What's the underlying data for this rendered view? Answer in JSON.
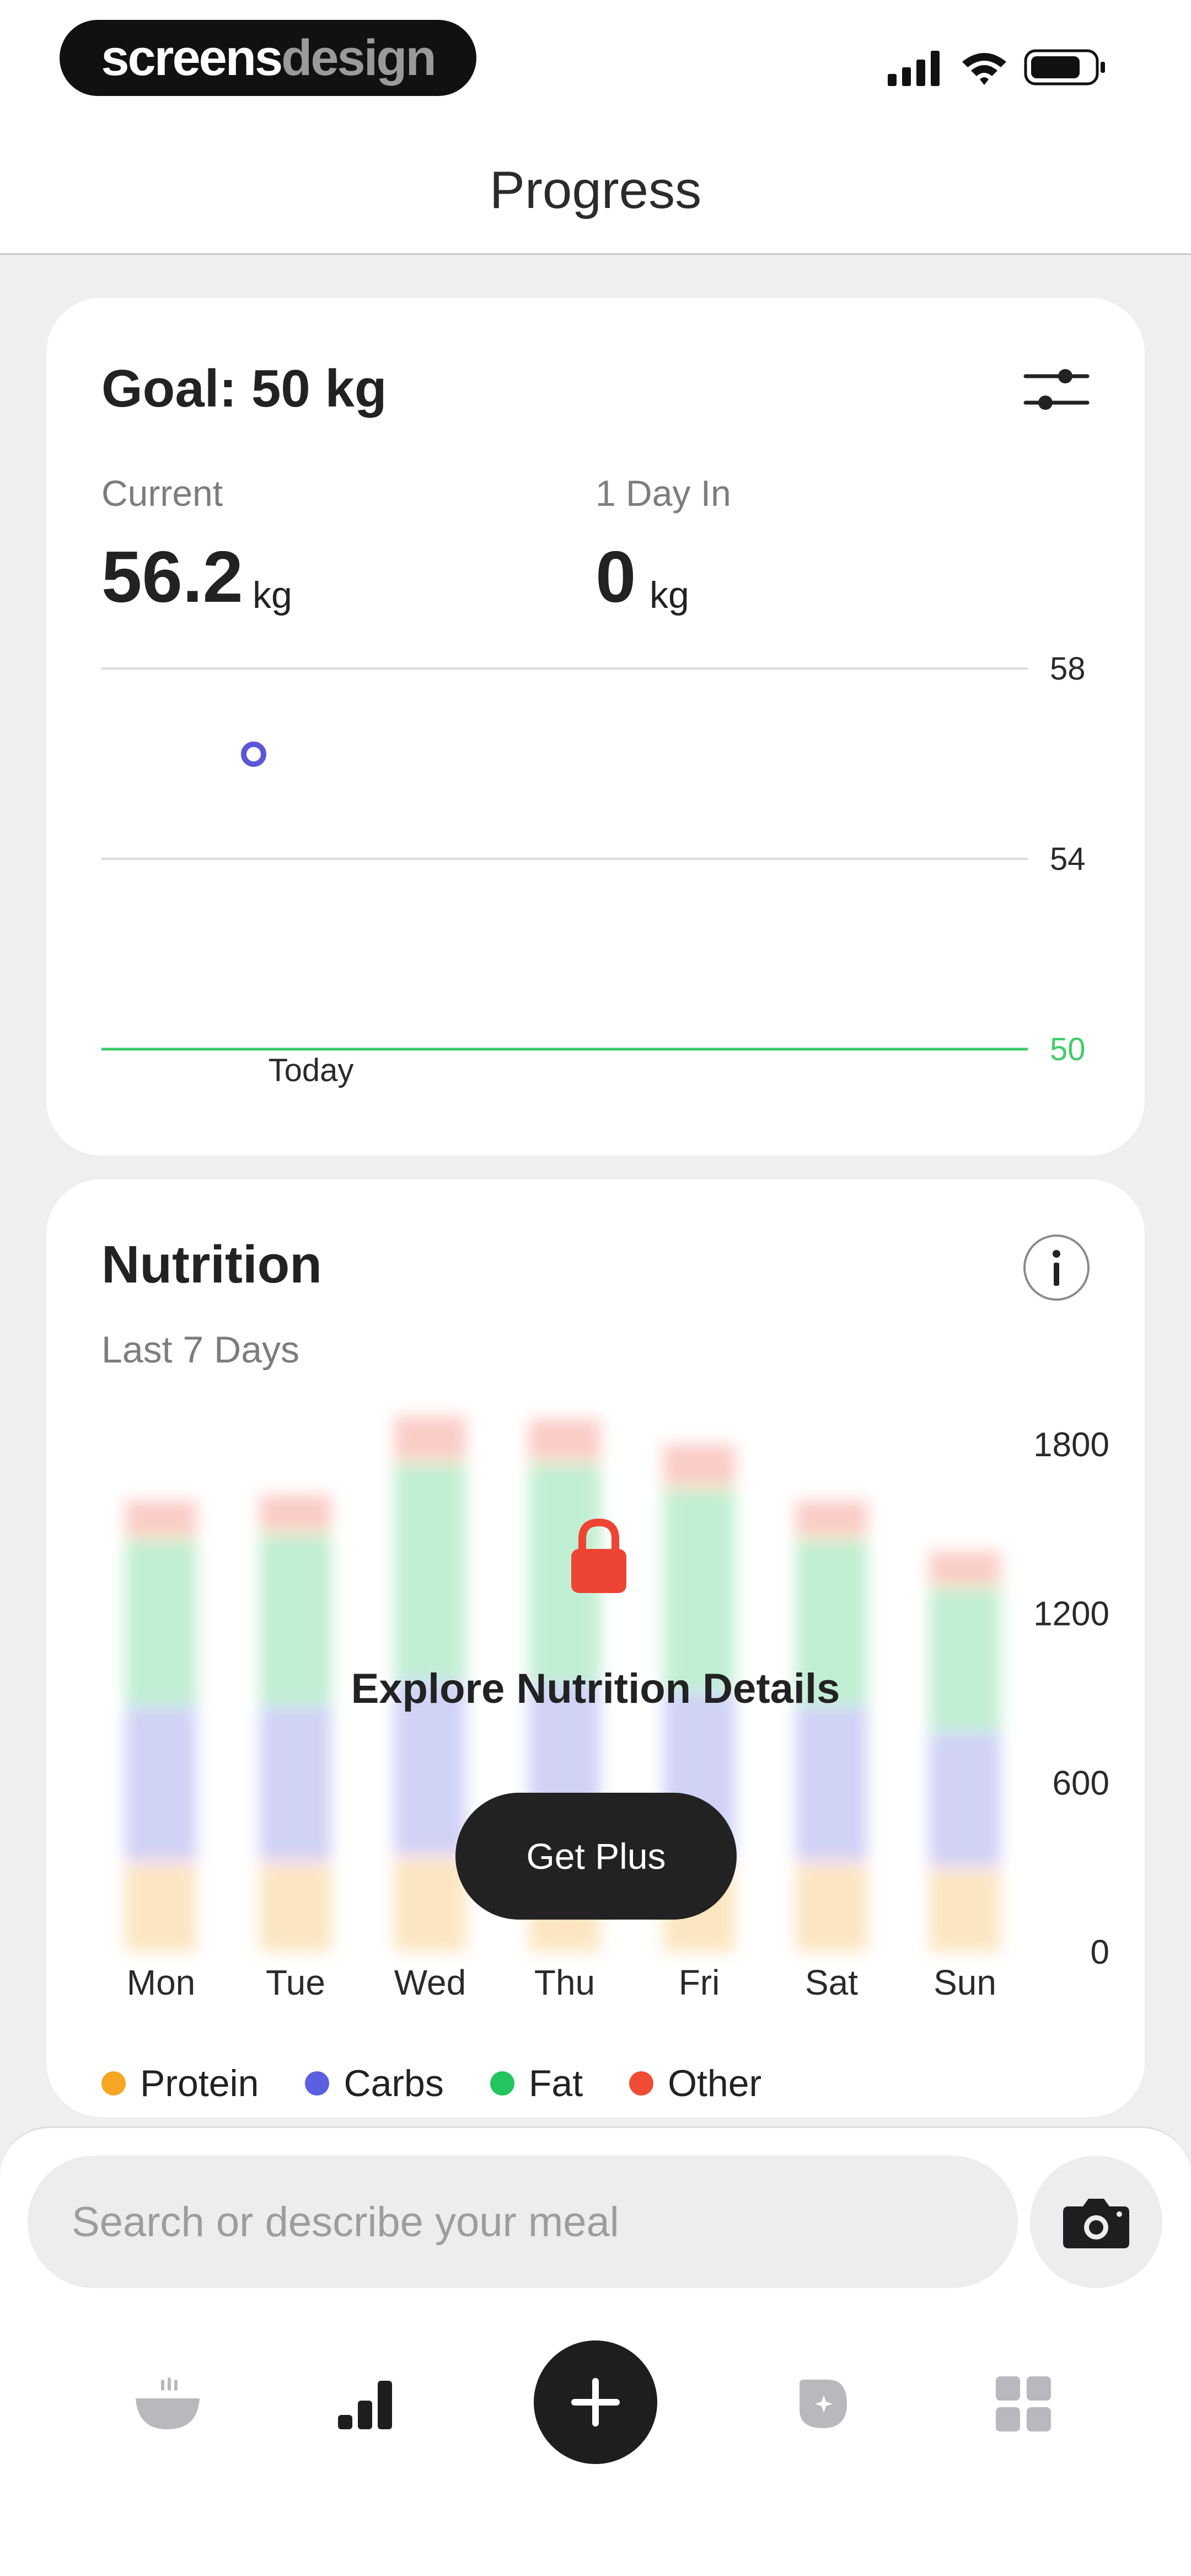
{
  "brand": {
    "part1": "screens",
    "part2": "design"
  },
  "header": {
    "title": "Progress"
  },
  "weight": {
    "goal_title": "Goal: 50 kg",
    "current_label": "Current",
    "current_value": "56.2",
    "current_unit": "kg",
    "change_label": "1 Day In",
    "change_value": "0",
    "change_unit": "kg"
  },
  "chart_data": [
    {
      "type": "scatter",
      "title": "",
      "xlabel": "",
      "ylabel": "",
      "categories": [
        "Today"
      ],
      "x_tick_labels": [
        "Today"
      ],
      "y_ticks": [
        50,
        54,
        58
      ],
      "y_tick_labels": [
        "50",
        "54",
        "58"
      ],
      "ylim": [
        50,
        58
      ],
      "goal_line": 50,
      "series": [
        {
          "values": [
            56.2
          ]
        }
      ],
      "grid": true,
      "colors": {
        "point": "#5b57d9",
        "goal": "#3fcc6a",
        "grid": "#dcdcdc"
      }
    },
    {
      "type": "bar",
      "title": "",
      "stacked": true,
      "blurred": true,
      "categories": [
        "Mon",
        "Tue",
        "Wed",
        "Thu",
        "Fri",
        "Sat",
        "Sun"
      ],
      "y_ticks": [
        0,
        600,
        1200,
        1800
      ],
      "y_tick_labels": [
        "0",
        "600",
        "1200",
        "1800"
      ],
      "ylim": [
        0,
        1800
      ],
      "legend_placement": "bottom-left",
      "series": [
        {
          "name": "Protein",
          "color": "#f5a623",
          "values": [
            320,
            320,
            340,
            330,
            320,
            320,
            300
          ]
        },
        {
          "name": "Carbs",
          "color": "#5a5fe0",
          "values": [
            550,
            550,
            620,
            620,
            600,
            550,
            480
          ]
        },
        {
          "name": "Fat",
          "color": "#22c55e",
          "values": [
            600,
            620,
            780,
            790,
            730,
            600,
            520
          ]
        },
        {
          "name": "Other",
          "color": "#ef4b35",
          "values": [
            130,
            130,
            160,
            150,
            150,
            130,
            120
          ]
        }
      ]
    }
  ],
  "nutrition": {
    "title": "Nutrition",
    "subtitle": "Last 7 Days",
    "locked_title": "Explore Nutrition Details",
    "cta_label": "Get Plus"
  },
  "search": {
    "placeholder": "Search or describe your meal"
  },
  "icons": {
    "filter": "sliders-icon",
    "info": "info-icon",
    "lock": "lock-icon",
    "camera": "camera-icon",
    "tabs": [
      "bowl-icon",
      "bar-chart-icon",
      "plus-icon",
      "badge-icon",
      "grid-icon"
    ]
  }
}
